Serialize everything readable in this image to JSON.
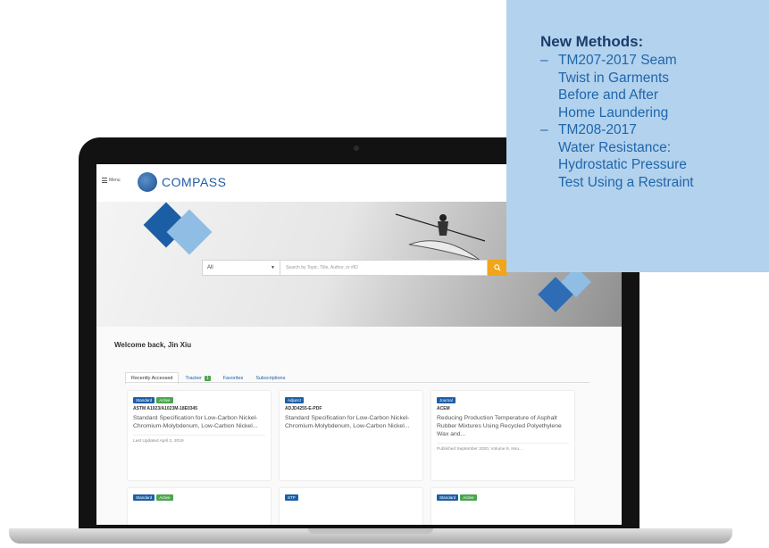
{
  "callout": {
    "heading": "New Methods:",
    "items": [
      {
        "dash": "–",
        "line1": "TM207-2017 Seam",
        "line2": "Twist in Garments",
        "line3": "Before and After",
        "line4": "Home Laundering"
      },
      {
        "dash": "–",
        "line1": "TM208-2017",
        "line2": "Water Resistance:",
        "line3": "Hydrostatic Pressure",
        "line4": "Test Using a Restraint"
      }
    ]
  },
  "app": {
    "menu_label": "Menu",
    "brand": "COMPASS",
    "search": {
      "scope_value": "All",
      "placeholder": "Search by Topic, Title, Author, or #ID"
    },
    "welcome": "Welcome back, Jin Xiu",
    "tabs": [
      {
        "label": "Recently Accessed"
      },
      {
        "label": "Tracker",
        "count": "1"
      },
      {
        "label": "Favorites"
      },
      {
        "label": "Subscriptions"
      }
    ],
    "cards": [
      {
        "badges": [
          "Standard",
          "Active"
        ],
        "code": "ASTM A1023/A1023M-18E0345",
        "title": "Standard Specification for Low-Carbon Nickel-Chromium-Molybdenum, Low-Carbon Nickel...",
        "meta": "Last Updated April 2, 2019"
      },
      {
        "badges": [
          "Adjunct"
        ],
        "code": "ADJD4255-E-PDF",
        "title": "Standard Specification for Low-Carbon Nickel-Chromium-Molybdenum, Low-Carbon Nickel...",
        "meta": ""
      },
      {
        "badges": [
          "Journal"
        ],
        "code": "ACEM",
        "title": "Reducing Production Temperature of Asphalt Rubber Mixtures Using Recycled Polyethylene Wax and...",
        "meta": "Published September 2020, Volume 9, Issu..."
      },
      {
        "badges": [
          "Standard",
          "Active"
        ]
      },
      {
        "badges": [
          "STP"
        ]
      },
      {
        "badges": [
          "Standard",
          "Active"
        ]
      }
    ]
  },
  "colors": {
    "callout_bg": "#b3d2ee",
    "callout_heading": "#1b3d6b",
    "callout_text": "#1f66ab",
    "brand_blue": "#1c5ea6",
    "search_button": "#f0a51a",
    "active_badge": "#4aa64e"
  },
  "icons": [
    "menu-icon",
    "compass-logo-icon",
    "dropdown-arrow-icon",
    "search-icon"
  ]
}
